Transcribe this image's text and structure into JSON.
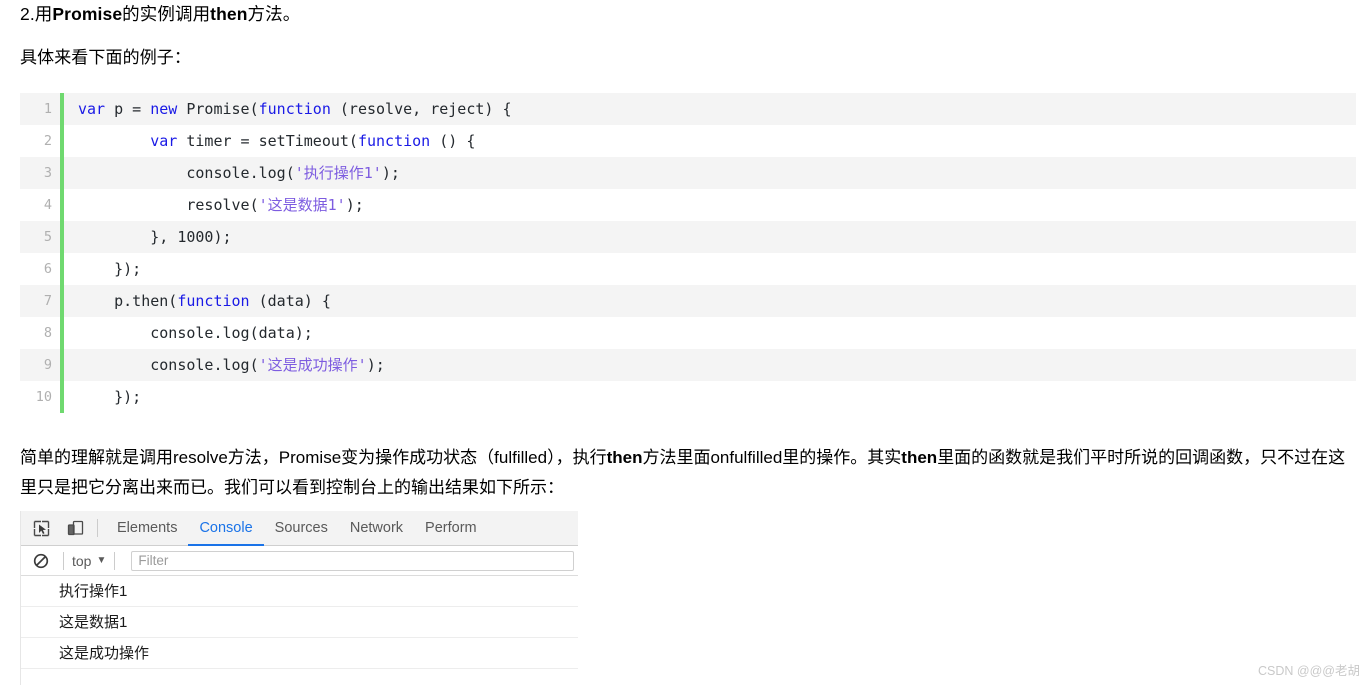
{
  "heading": {
    "prefix": "2.用",
    "bold1": "Promise",
    "mid": "的实例调用",
    "bold2": "then",
    "suffix": "方法。"
  },
  "subheading": "具体来看下面的例子：",
  "code": {
    "lines": [
      {
        "number": "1",
        "tokens": [
          {
            "text": "var",
            "type": "kw"
          },
          {
            "text": " p = ",
            "type": "plain"
          },
          {
            "text": "new",
            "type": "kw"
          },
          {
            "text": " Promise(",
            "type": "plain"
          },
          {
            "text": "function",
            "type": "kw"
          },
          {
            "text": " (resolve, reject) {",
            "type": "plain"
          }
        ]
      },
      {
        "number": "2",
        "tokens": [
          {
            "text": "        ",
            "type": "plain"
          },
          {
            "text": "var",
            "type": "kw"
          },
          {
            "text": " timer = setTimeout(",
            "type": "plain"
          },
          {
            "text": "function",
            "type": "kw"
          },
          {
            "text": " () {",
            "type": "plain"
          }
        ]
      },
      {
        "number": "3",
        "tokens": [
          {
            "text": "            console.log(",
            "type": "plain"
          },
          {
            "text": "'执行操作1'",
            "type": "str"
          },
          {
            "text": ");",
            "type": "plain"
          }
        ]
      },
      {
        "number": "4",
        "tokens": [
          {
            "text": "            resolve(",
            "type": "plain"
          },
          {
            "text": "'这是数据1'",
            "type": "str"
          },
          {
            "text": ");",
            "type": "plain"
          }
        ]
      },
      {
        "number": "5",
        "tokens": [
          {
            "text": "        }, 1000);",
            "type": "plain"
          }
        ]
      },
      {
        "number": "6",
        "tokens": [
          {
            "text": "    });",
            "type": "plain"
          }
        ]
      },
      {
        "number": "7",
        "tokens": [
          {
            "text": "    p.then(",
            "type": "plain"
          },
          {
            "text": "function",
            "type": "kw"
          },
          {
            "text": " (data) {",
            "type": "plain"
          }
        ]
      },
      {
        "number": "8",
        "tokens": [
          {
            "text": "        console.log(data);",
            "type": "plain"
          }
        ]
      },
      {
        "number": "9",
        "tokens": [
          {
            "text": "        console.log(",
            "type": "plain"
          },
          {
            "text": "'这是成功操作'",
            "type": "str"
          },
          {
            "text": ");",
            "type": "plain"
          }
        ]
      },
      {
        "number": "10",
        "tokens": [
          {
            "text": "    });",
            "type": "plain"
          }
        ]
      }
    ],
    "accent_color": "#6fd96f",
    "stripe_color": "#f4f4f4",
    "keyword_color": "#1a1ae6",
    "string_color": "#7d5ce0"
  },
  "paragraph": {
    "part1": "简单的理解就是调用resolve方法，Promise变为操作成功状态（fulfilled），执行",
    "bold1": "then",
    "part2": "方法里面onfulfilled里的操作。其实",
    "bold2": "then",
    "part3": "里面的函数就是我们平时所说的回调函数，只不过在这里只是把它分离出来而已。我们可以看到控制台上的输出结果如下所示："
  },
  "devtools": {
    "inspect_icon": "inspect-element-icon",
    "device_icon": "device-toolbar-icon",
    "tabs": [
      {
        "label": "Elements",
        "active": false
      },
      {
        "label": "Console",
        "active": true
      },
      {
        "label": "Sources",
        "active": false
      },
      {
        "label": "Network",
        "active": false
      },
      {
        "label": "Perform",
        "active": false
      }
    ],
    "clear_icon": "clear-console-icon",
    "context": "top",
    "context_caret": "▼",
    "filter_placeholder": "Filter",
    "filter_value": "",
    "messages": [
      "执行操作1",
      "这是数据1",
      "这是成功操作"
    ],
    "active_tab_color": "#1a73e8"
  },
  "watermark": "CSDN @@@老胡"
}
